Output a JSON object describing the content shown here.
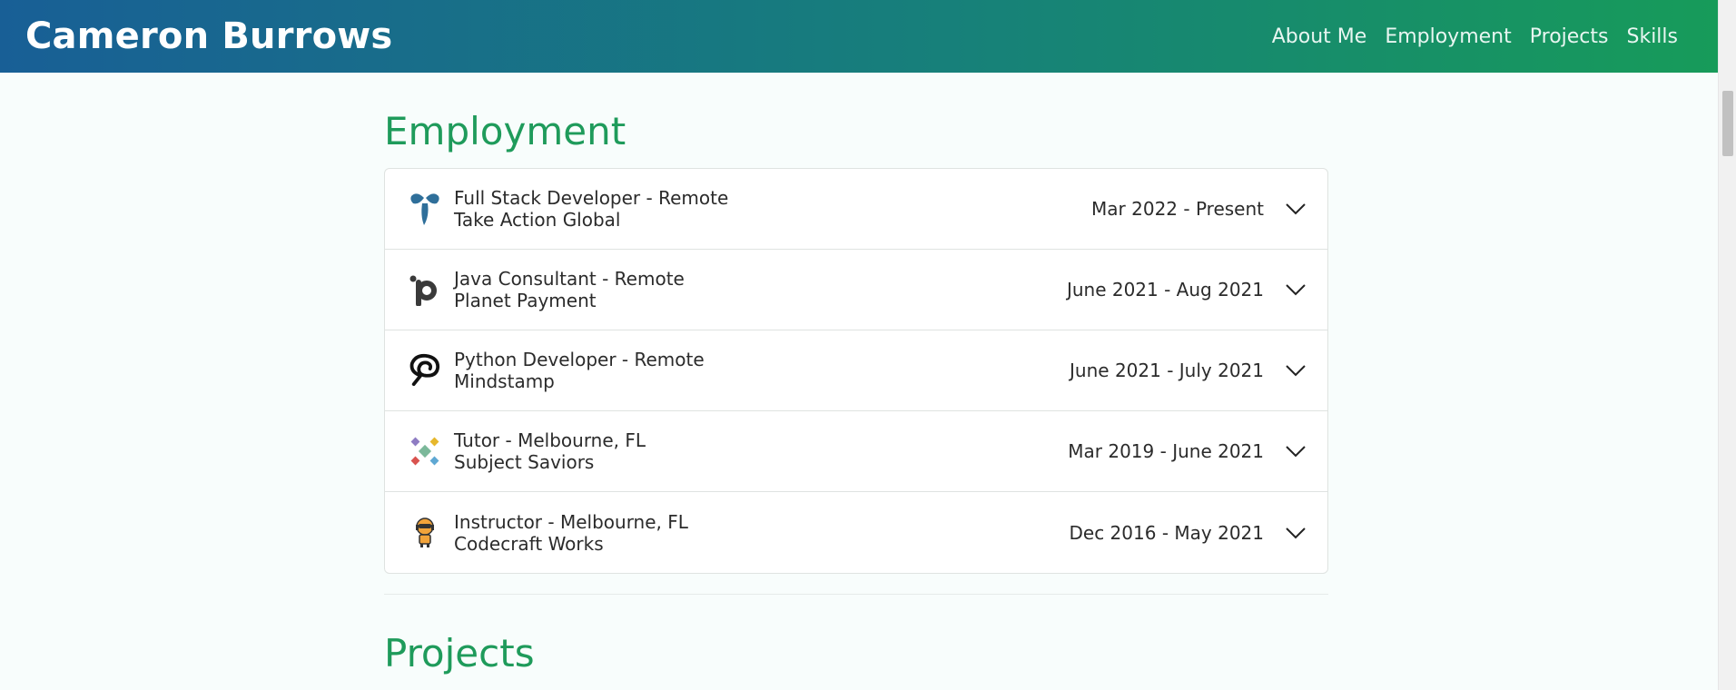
{
  "header": {
    "brand": "Cameron Burrows",
    "nav": [
      "About Me",
      "Employment",
      "Projects",
      "Skills"
    ]
  },
  "employment": {
    "title": "Employment",
    "jobs": [
      {
        "title": "Full Stack Developer - Remote",
        "company": "Take Action Global",
        "dates": "Mar 2022 - Present",
        "logo_icon": "take-action-global-logo-icon"
      },
      {
        "title": "Java Consultant - Remote",
        "company": "Planet Payment",
        "dates": "June 2021 - Aug 2021",
        "logo_icon": "planet-payment-logo-icon"
      },
      {
        "title": "Python Developer - Remote",
        "company": "Mindstamp",
        "dates": "June 2021 - July 2021",
        "logo_icon": "mindstamp-logo-icon"
      },
      {
        "title": "Tutor - Melbourne, FL",
        "company": "Subject Saviors",
        "dates": "Mar 2019 - June 2021",
        "logo_icon": "subject-saviors-logo-icon"
      },
      {
        "title": "Instructor - Melbourne, FL",
        "company": "Codecraft Works",
        "dates": "Dec 2016 - May 2021",
        "logo_icon": "codecraft-works-logo-icon"
      }
    ]
  },
  "projects": {
    "title": "Projects"
  },
  "colors": {
    "accent": "#1f9b5b",
    "header_gradient_start": "#185f96",
    "header_gradient_end": "#179b5a"
  }
}
